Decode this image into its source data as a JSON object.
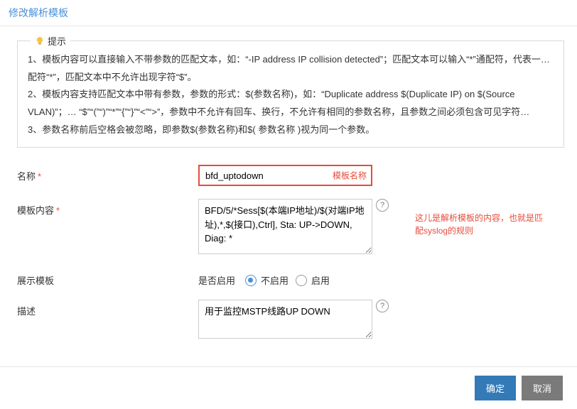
{
  "page_title": "修改解析模板",
  "tips": {
    "legend": "提示",
    "line1": "1、模板内容可以直接输入不带参数的匹配文本，如：“-IP address IP collision detected”；匹配文本可以输入“*”通配符，代表一… 配符“*”，匹配文本中不允许出现字符“$”。",
    "line2": "2、模板内容支持匹配文本中带有参数，参数的形式：$(参数名称)，如：“Duplicate address $(Duplicate IP) on $(Source VLAN)”；… “$”“(”“)”“*”“{”“}”“<”“>”，参数中不允许有回车、换行，不允许有相同的参数名称，且参数之间必须包含可见字符…",
    "line3": "3、参数名称前后空格会被忽略，即参数$(参数名称)和$( 参数名称 )视为同一个参数。"
  },
  "form": {
    "name": {
      "label": "名称",
      "value": "bfd_uptodown",
      "overlay": "模板名称"
    },
    "template_content": {
      "label": "模板内容",
      "value": "BFD/5/*Sess[$(本端IP地址)/$(对端IP地址),*,$(接口),Ctrl], Sta: UP->DOWN, Diag: *",
      "note": "这儿是解析模板的内容，也就是匹配syslog的规则"
    },
    "display_template": {
      "label": "展示模板",
      "prefix": "是否启用",
      "options": {
        "off": "不启用",
        "on": "启用"
      },
      "selected": "off"
    },
    "description": {
      "label": "描述",
      "value": "用于监控MSTP线路UP DOWN"
    }
  },
  "buttons": {
    "ok": "确定",
    "cancel": "取消"
  }
}
